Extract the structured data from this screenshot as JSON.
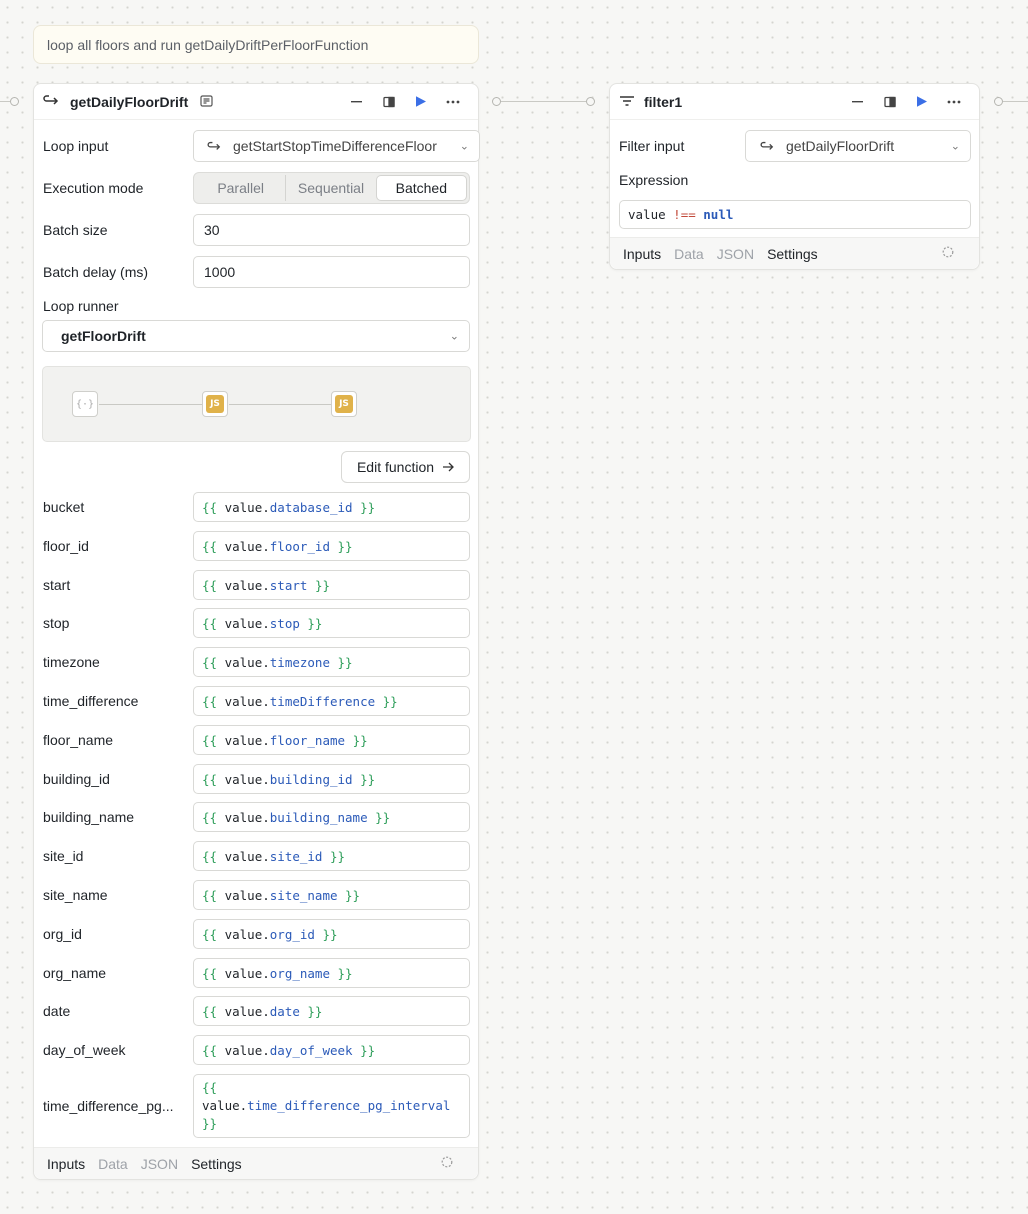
{
  "note": {
    "text": "loop all floors and run getDailyDriftPerFloorFunction"
  },
  "loop_node": {
    "title": "getDailyFloorDrift",
    "loop_input_label": "Loop input",
    "loop_input_value": "getStartStopTimeDifferenceFloor",
    "execution_mode_label": "Execution mode",
    "execution_modes": [
      "Parallel",
      "Sequential",
      "Batched"
    ],
    "execution_mode_selected": "Batched",
    "batch_size_label": "Batch size",
    "batch_size_value": "30",
    "batch_delay_label": "Batch delay (ms)",
    "batch_delay_value": "1000",
    "loop_runner_label": "Loop runner",
    "loop_runner_value": "getFloorDrift",
    "preview_js_a": "JS",
    "preview_js_b": "JS",
    "edit_function_label": "Edit function",
    "params": [
      {
        "name": "bucket",
        "open": "{{",
        "obj": "value",
        "prop": "database_id",
        "close": "}}"
      },
      {
        "name": "floor_id",
        "open": "{{",
        "obj": "value",
        "prop": "floor_id",
        "close": "}}"
      },
      {
        "name": "start",
        "open": "{{",
        "obj": "value",
        "prop": "start",
        "close": "}}"
      },
      {
        "name": "stop",
        "open": "{{",
        "obj": "value",
        "prop": "stop",
        "close": "}}"
      },
      {
        "name": "timezone",
        "open": "{{",
        "obj": "value",
        "prop": "timezone",
        "close": "}}"
      },
      {
        "name": "time_difference",
        "open": "{{",
        "obj": "value",
        "prop": "timeDifference",
        "close": "}}"
      },
      {
        "name": "floor_name",
        "open": "{{",
        "obj": "value",
        "prop": "floor_name",
        "close": "}}"
      },
      {
        "name": "building_id",
        "open": "{{",
        "obj": "value",
        "prop": "building_id",
        "close": "}}"
      },
      {
        "name": "building_name",
        "open": "{{",
        "obj": "value",
        "prop": "building_name",
        "close": "}}"
      },
      {
        "name": "site_id",
        "open": "{{",
        "obj": "value",
        "prop": "site_id",
        "close": "}}"
      },
      {
        "name": "site_name",
        "open": "{{",
        "obj": "value",
        "prop": "site_name",
        "close": "}}"
      },
      {
        "name": "org_id",
        "open": "{{",
        "obj": "value",
        "prop": "org_id",
        "close": "}}"
      },
      {
        "name": "org_name",
        "open": "{{",
        "obj": "value",
        "prop": "org_name",
        "close": "}}"
      },
      {
        "name": "date",
        "open": "{{",
        "obj": "value",
        "prop": "date",
        "close": "}}"
      },
      {
        "name": "day_of_week",
        "open": "{{",
        "obj": "value",
        "prop": "day_of_week",
        "close": "}}"
      }
    ],
    "last_param": {
      "name": "time_difference_pg...",
      "open": "{{",
      "obj": "value",
      "prop": "time_difference_pg_interval",
      "close": "}}"
    },
    "footer_tabs": [
      "Inputs",
      "Data",
      "JSON",
      "Settings"
    ]
  },
  "filter_node": {
    "title": "filter1",
    "filter_input_label": "Filter input",
    "filter_input_value": "getDailyFloorDrift",
    "expression_label": "Expression",
    "expr_value": "value",
    "expr_op": "!==",
    "expr_null": "null",
    "footer_tabs": [
      "Inputs",
      "Data",
      "JSON",
      "Settings"
    ]
  },
  "icons": [
    "loop-icon",
    "docs-icon",
    "minimize-icon",
    "panel-icon",
    "run-icon",
    "more-icon",
    "filter-icon",
    "chevron-down-icon",
    "json-icon",
    "arrow-right-icon",
    "spinner-icon"
  ],
  "colors": {
    "run_accent": "#3b6fe6",
    "template_brace": "#2e9e5a",
    "template_prop": "#2b5ab8",
    "js_badge": "#e0b24a"
  }
}
